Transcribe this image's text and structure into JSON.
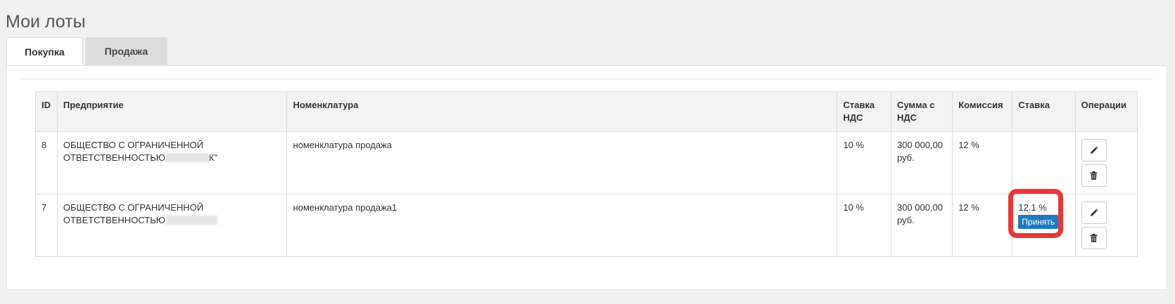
{
  "page": {
    "title": "Мои лоты"
  },
  "tabs": [
    {
      "label": "Покупка",
      "active": true
    },
    {
      "label": "Продажа",
      "active": false
    }
  ],
  "table": {
    "headers": {
      "id": "ID",
      "company": "Предприятие",
      "nomenclature": "Номенклатура",
      "vat_rate_line1": "Ставка",
      "vat_rate_line2": "НДС",
      "sum_vat_line1": "Сумма с",
      "sum_vat_line2": "НДС",
      "commission": "Комиссия",
      "stake": "Ставка",
      "operations": "Операции"
    },
    "rows": [
      {
        "id": "8",
        "company_line1": "ОБЩЕСТВО С ОГРАНИЧЕННОЙ",
        "company_line2": "ОТВЕТСТВЕННОСТЬЮ",
        "company_suffix": "К\"",
        "nomenclature": "номенклатура продажа",
        "vat_rate": "10 %",
        "sum_line1": "300 000,00",
        "sum_line2": "руб.",
        "commission": "12 %",
        "stake": "",
        "accept_label": ""
      },
      {
        "id": "7",
        "company_line1": "ОБЩЕСТВО С ОГРАНИЧЕННОЙ",
        "company_line2": "ОТВЕТСТВЕННОСТЬЮ",
        "company_suffix": "",
        "nomenclature": "номенклатура продажа1",
        "vat_rate": "10 %",
        "sum_line1": "300 000,00",
        "sum_line2": "руб.",
        "commission": "12 %",
        "stake": "12.1 %",
        "accept_label": "Принять"
      }
    ]
  },
  "icons": {
    "edit": "pencil-icon",
    "delete": "trash-icon"
  },
  "colors": {
    "accept_button": "#1f7bc1",
    "highlight": "#e53935"
  }
}
